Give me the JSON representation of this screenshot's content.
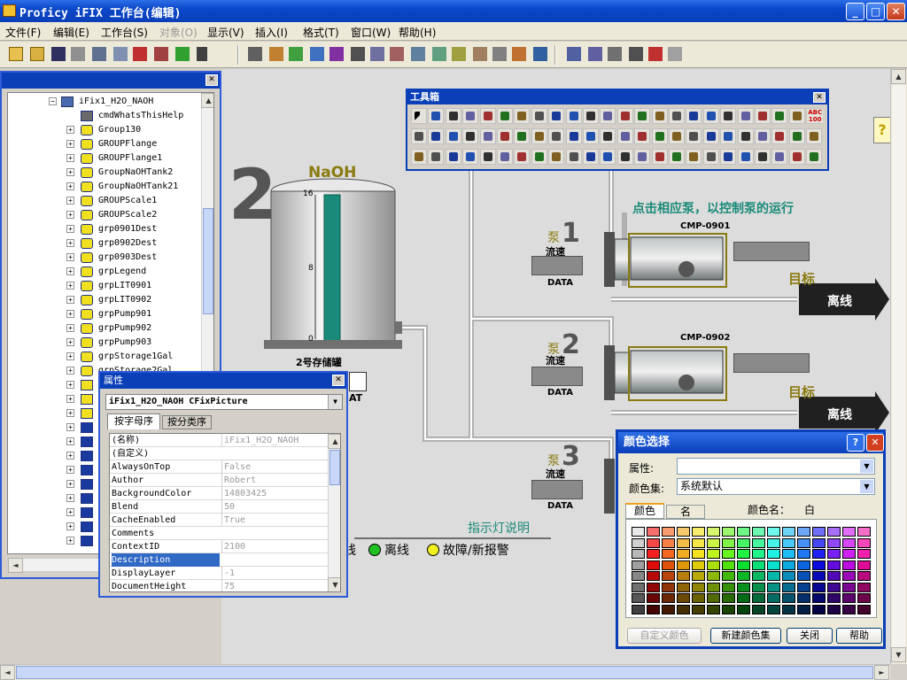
{
  "window": {
    "title": "Proficy iFIX 工作台(编辑)",
    "min": "_",
    "max": "□",
    "close": "✕"
  },
  "menu": [
    "文件(F)",
    "编辑(E)",
    "工作台(S)",
    "对象(O)",
    "显示(V)",
    "插入(I)",
    "格式(T)",
    "窗口(W)",
    "帮助(H)"
  ],
  "tree": {
    "root": "iFix1_H2O_NAOH",
    "items": [
      "cmdWhatsThisHelp",
      "Group130",
      "GROUPFlange",
      "GROUPFlange1",
      "GroupNaOHTank2",
      "GroupNaOHTank21",
      "GROUPScale1",
      "GROUPScale2",
      "grp0901Dest",
      "grp0902Dest",
      "grp0903Dest",
      "grpLegend",
      "grpLIT0901",
      "grpLIT0902",
      "grpPump901",
      "grpPump902",
      "grpPump903",
      "grpStorage1Gal",
      "grpStorage2Gal"
    ]
  },
  "toolbox": {
    "title": "工具箱",
    "close": "✕",
    "abc": "ABC 100"
  },
  "tank": {
    "number": "2",
    "chem": "NaOH",
    "ticks": [
      "16",
      "8",
      "0"
    ],
    "level_pct": 100,
    "label": "2号存储罐",
    "badge": "AT"
  },
  "pumps": [
    {
      "zh": "泵",
      "num": "1",
      "flow": "流速",
      "data": "DATA",
      "tag": "CMP-0901",
      "target": "目标",
      "status": "离线"
    },
    {
      "zh": "泵",
      "num": "2",
      "flow": "流速",
      "data": "DATA",
      "tag": "CMP-0902",
      "target": "目标",
      "status": "离线"
    },
    {
      "zh": "泵",
      "num": "3",
      "flow": "流速",
      "data": "DATA"
    }
  ],
  "instruction": "点击相应泵，以控制泵的运行",
  "legend": {
    "title": "指示灯说明",
    "partial": "线",
    "offline": "离线",
    "fault": "故障/新报警"
  },
  "properties": {
    "title": "属性",
    "close": "✕",
    "object": "iFix1_H2O_NAOH CFixPicture",
    "tabs": [
      "按字母序",
      "按分类序"
    ],
    "rows": [
      {
        "k": "(名称)",
        "v": "iFix1_H2O_NAOH"
      },
      {
        "k": "(自定义)",
        "v": ""
      },
      {
        "k": "AlwaysOnTop",
        "v": "False"
      },
      {
        "k": "Author",
        "v": "Robert"
      },
      {
        "k": "BackgroundColor",
        "v": "14803425"
      },
      {
        "k": "Blend",
        "v": "50"
      },
      {
        "k": "CacheEnabled",
        "v": "True"
      },
      {
        "k": "Comments",
        "v": ""
      },
      {
        "k": "ContextID",
        "v": "2100"
      },
      {
        "k": "Description",
        "v": ""
      },
      {
        "k": "DisplayLayer",
        "v": "-1"
      },
      {
        "k": "DocumentHeight",
        "v": "75"
      }
    ]
  },
  "color_dialog": {
    "title": "颜色选择",
    "help": "?",
    "close": "✕",
    "prop_label": "属性:",
    "set_label": "颜色集:",
    "set_value": "系统默认",
    "tabs": [
      "颜色",
      "名"
    ],
    "name_label": "颜色名：",
    "name_value": "白",
    "buttons": [
      "自定义颜色",
      "新建颜色集",
      "关闭",
      "帮助"
    ]
  },
  "colors": {
    "accent": "#0a3fb8",
    "teal": "#1a8a7a",
    "olive": "#8a7a10",
    "tank_fill": "#1a8a7a"
  }
}
